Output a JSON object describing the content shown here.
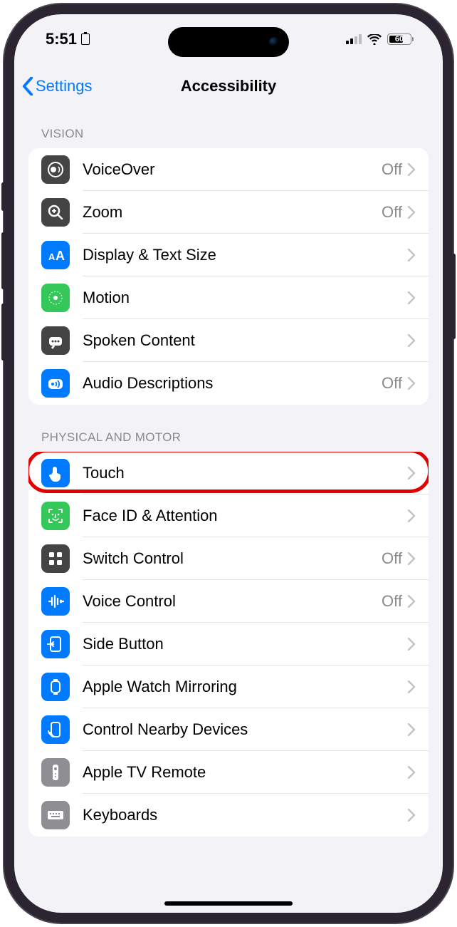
{
  "status": {
    "time": "5:51",
    "battery": "60"
  },
  "nav": {
    "back": "Settings",
    "title": "Accessibility"
  },
  "sections": {
    "vision": {
      "header": "VISION",
      "items": [
        {
          "label": "VoiceOver",
          "value": "Off",
          "icon": "voiceover",
          "bg": "#444"
        },
        {
          "label": "Zoom",
          "value": "Off",
          "icon": "zoom",
          "bg": "#444"
        },
        {
          "label": "Display & Text Size",
          "value": "",
          "icon": "textsize",
          "bg": "#007aff"
        },
        {
          "label": "Motion",
          "value": "",
          "icon": "motion",
          "bg": "#34c759"
        },
        {
          "label": "Spoken Content",
          "value": "",
          "icon": "spoken",
          "bg": "#444"
        },
        {
          "label": "Audio Descriptions",
          "value": "Off",
          "icon": "audiodesc",
          "bg": "#007aff"
        }
      ]
    },
    "physical": {
      "header": "PHYSICAL AND MOTOR",
      "items": [
        {
          "label": "Touch",
          "value": "",
          "icon": "touch",
          "bg": "#007aff",
          "highlight": true
        },
        {
          "label": "Face ID & Attention",
          "value": "",
          "icon": "faceid",
          "bg": "#34c759"
        },
        {
          "label": "Switch Control",
          "value": "Off",
          "icon": "switch",
          "bg": "#444"
        },
        {
          "label": "Voice Control",
          "value": "Off",
          "icon": "voicecontrol",
          "bg": "#007aff"
        },
        {
          "label": "Side Button",
          "value": "",
          "icon": "sidebutton",
          "bg": "#007aff"
        },
        {
          "label": "Apple Watch Mirroring",
          "value": "",
          "icon": "watchmirror",
          "bg": "#007aff"
        },
        {
          "label": "Control Nearby Devices",
          "value": "",
          "icon": "nearby",
          "bg": "#007aff"
        },
        {
          "label": "Apple TV Remote",
          "value": "",
          "icon": "tvremote",
          "bg": "#8e8e93"
        },
        {
          "label": "Keyboards",
          "value": "",
          "icon": "keyboards",
          "bg": "#8e8e93"
        }
      ]
    }
  }
}
